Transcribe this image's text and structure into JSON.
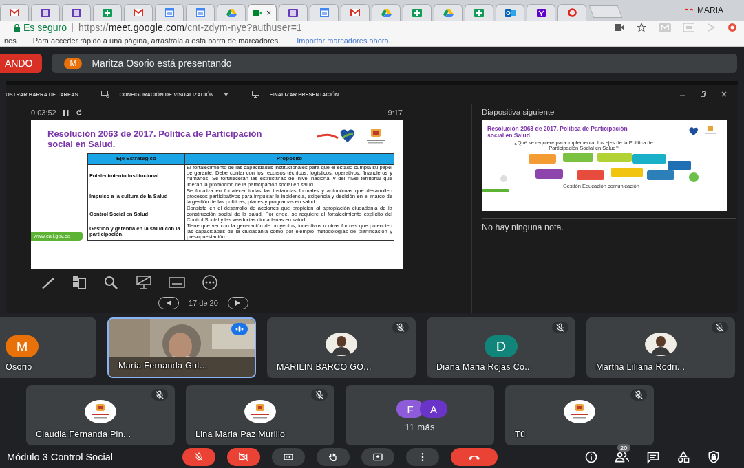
{
  "browser": {
    "tabs": [
      {
        "kind": "mail",
        "selected": false
      },
      {
        "kind": "list",
        "selected": false
      },
      {
        "kind": "list",
        "selected": false
      },
      {
        "kind": "sheet",
        "selected": false
      },
      {
        "kind": "mail",
        "selected": false
      },
      {
        "kind": "calendar",
        "selected": false
      },
      {
        "kind": "calendar",
        "selected": false
      },
      {
        "kind": "drive",
        "selected": false
      },
      {
        "kind": "meet",
        "selected": true,
        "close": "×"
      },
      {
        "kind": "list",
        "selected": false
      },
      {
        "kind": "calendar",
        "selected": false
      },
      {
        "kind": "mail",
        "selected": false
      },
      {
        "kind": "drive",
        "selected": false
      },
      {
        "kind": "sheet",
        "selected": false
      },
      {
        "kind": "drive",
        "selected": false
      },
      {
        "kind": "sheet",
        "selected": false
      },
      {
        "kind": "outlook",
        "selected": false
      },
      {
        "kind": "yahoo",
        "selected": false
      },
      {
        "kind": "ring",
        "selected": false
      }
    ],
    "profile": "MARIA",
    "security": "Es seguro",
    "url": "https://**meet.google.com**/cnt-zdym-nye?authuser=1",
    "bookmarks_bar": {
      "cut_text": "nes",
      "hint": "Para acceder rápido a una página, arrástrala a esta barra de marcadores.",
      "link": "Importar marcadores ahora..."
    }
  },
  "meet": {
    "presenting_button": "ANDO",
    "presenter": {
      "letter": "M",
      "color": "#e8710a",
      "text": "Maritza Osorio está presentando"
    },
    "presenter_view": {
      "toolbar": [
        {
          "kind": "taskbar",
          "label": "OSTRAR BARRA DE TAREAS"
        },
        {
          "kind": "display",
          "label": "CONFIGURACIÓN DE VISUALIZACIÓN"
        },
        {
          "kind": "end",
          "label": "FINALIZAR PRESENTACIÓN"
        }
      ],
      "elapsed": "0:03:52",
      "clock": "9:17",
      "slide": {
        "title": "Resolución 2063 de 2017. Política de Participación social en Salud.",
        "table": {
          "columns": [
            "Eje Estratégico",
            "Propósito"
          ],
          "rows": [
            [
              "Fotalecimiento Institucional",
              "El fortalecimiento de las capacidades institucionales para que el estado cumpla su papel de garante. Debe contar con los recursos técnicos, logísticos, operativos, financieros y humanos. Se fortalecerán las estructuras del nivel nacional y del nivel territorial que lideran la promoción de la participación social en salud."
            ],
            [
              "Impulso a la cultura de la Salud",
              "Se focaliza en fortalecer todas las instancias formales y autonómas que desarrollen procesos participativos para impulsar la incidencia, exigencia y decisión en el marco de la gestión de las políticas, planes y programas en salud."
            ],
            [
              "Control Social en Salud",
              "Consiste en el desarrollo de acciones que propicien al apropiación ciudadania de la construcción social de la salud. Por ende, se requiere el fortalecimiento explicito del Control Social y las veedurías ciudadanas en salud."
            ],
            [
              "Gestión y garantía  en la salud con la participación.",
              "Tiene que ver con la generación de proyectos, incentivos u otras formas que potencien las capacidades de la ciudadanía como por ejemplo metodologías de planificación y presupuestación."
            ]
          ]
        },
        "footer": "www.cali.gov.co"
      },
      "slide_counter": "17 de 20",
      "next_label": "Diapositiva siguiente",
      "next_slide": {
        "title": "Resolución 2063 de 2017. Política de Participación social en Salud.",
        "question": "¿Qué se requiere para implementar los ejes de la Política de Participación Social en Salud?",
        "caption": "Gestión Educación comunicación"
      },
      "notes": "No hay ninguna nota."
    },
    "participants": [
      {
        "kind": "letter",
        "letter": "M",
        "color": "#e8710a",
        "name": "Osorio",
        "muted": false,
        "speaking": false
      },
      {
        "kind": "video",
        "name": "María Fernanda Gut...",
        "muted": false,
        "speaking": true
      },
      {
        "name": "MARILIN BARCO GO...",
        "muted": true,
        "speaking": false
      },
      {
        "kind": "letter",
        "letter": "D",
        "color": "#12857a",
        "name": "Diana Maria Rojas Co...",
        "muted": true,
        "speaking": false
      },
      {
        "name": "Martha Liliana Rodri...",
        "muted": true,
        "speaking": false
      },
      {
        "kind": "logo",
        "name": "Claudia Fernanda Pin...",
        "muted": true,
        "speaking": false
      },
      {
        "kind": "logo",
        "name": "Lina Maria Paz Murillo",
        "muted": true,
        "speaking": false
      },
      {
        "kind": "more",
        "name": "11 más",
        "avatars": [
          {
            "letter": "F",
            "color": "#8e5cd9"
          },
          {
            "letter": "A",
            "color": "#6b34c9"
          }
        ]
      },
      {
        "kind": "logo",
        "name": "Tú",
        "muted": true,
        "speaking": false
      }
    ],
    "meeting_name": "Módulo 3 Control Social",
    "controls": [
      {
        "kind": "mic",
        "on": false
      },
      {
        "kind": "camera",
        "on": false
      },
      {
        "kind": "captions"
      },
      {
        "kind": "hand"
      },
      {
        "kind": "present"
      },
      {
        "kind": "more"
      },
      {
        "kind": "hangup"
      }
    ],
    "side_controls": [
      {
        "kind": "info"
      },
      {
        "kind": "people",
        "badge": "20"
      },
      {
        "kind": "chat"
      },
      {
        "kind": "activities"
      },
      {
        "kind": "lock"
      }
    ]
  }
}
